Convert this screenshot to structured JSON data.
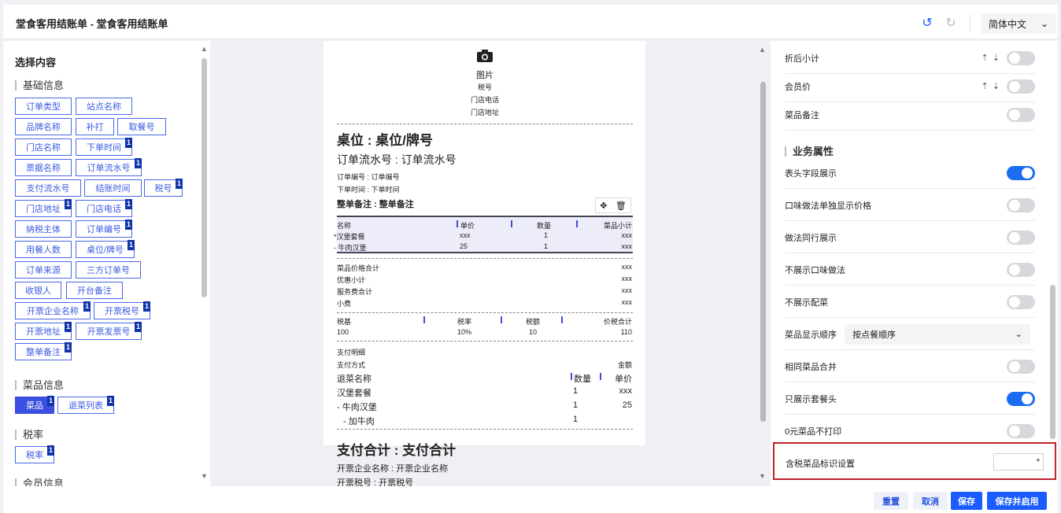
{
  "header": {
    "title": "堂食客用结账单 - 堂食客用结账单",
    "undo_icon": "undo-icon",
    "redo_icon": "redo-icon",
    "language": "简体中文"
  },
  "left": {
    "section_title": "选择内容",
    "groups": [
      {
        "name": "基础信息",
        "items": [
          {
            "label": "订单类型",
            "badge": ""
          },
          {
            "label": "站点名称",
            "badge": ""
          },
          {
            "label": "品牌名称",
            "badge": ""
          },
          {
            "label": "补打",
            "badge": ""
          },
          {
            "label": "取餐号",
            "badge": ""
          },
          {
            "label": "门店名称",
            "badge": ""
          },
          {
            "label": "下单时间",
            "badge": "1"
          },
          {
            "label": "票据名称",
            "badge": ""
          },
          {
            "label": "订单流水号",
            "badge": "1"
          },
          {
            "label": "支付流水号",
            "badge": ""
          },
          {
            "label": "结账时间",
            "badge": ""
          },
          {
            "label": "税号",
            "badge": "1"
          },
          {
            "label": "门店地址",
            "badge": "1"
          },
          {
            "label": "门店电话",
            "badge": "1"
          },
          {
            "label": "纳税主体",
            "badge": ""
          },
          {
            "label": "订单编号",
            "badge": "1"
          },
          {
            "label": "用餐人数",
            "badge": ""
          },
          {
            "label": "桌位/牌号",
            "badge": "1"
          },
          {
            "label": "订单来源",
            "badge": ""
          },
          {
            "label": "三方订单号",
            "badge": ""
          },
          {
            "label": "收银人",
            "badge": ""
          },
          {
            "label": "开台备注",
            "badge": ""
          },
          {
            "label": "开票企业名称",
            "badge": "1"
          },
          {
            "label": "开票税号",
            "badge": "1"
          },
          {
            "label": "开票地址",
            "badge": "1"
          },
          {
            "label": "开票发票号",
            "badge": "1"
          },
          {
            "label": "整单备注",
            "badge": "1"
          }
        ]
      },
      {
        "name": "菜品信息",
        "items": [
          {
            "label": "菜品",
            "badge": "1"
          },
          {
            "label": "退菜列表",
            "badge": "1"
          }
        ]
      },
      {
        "name": "税率",
        "items": [
          {
            "label": "税率",
            "badge": "1"
          }
        ]
      },
      {
        "name": "会员信息",
        "items": []
      }
    ]
  },
  "receipt": {
    "camera_icon": "camera-icon",
    "image_label": "图片",
    "tax_no": "税号",
    "store_phone": "门店电话",
    "store_addr": "门店地址",
    "table_no": "桌位 : 桌位/牌号",
    "serial_no": "订单流水号 : 订单流水号",
    "order_no": "订单编号 : 订单编号",
    "order_time": "下单时间 : 下单时间",
    "order_remark": "整单备注 : 整单备注",
    "move_icon": "move-icon",
    "delete_icon": "trash-icon",
    "dish_table": {
      "headers": [
        "名称",
        "单价",
        "数量",
        "菜品小计"
      ],
      "rows": [
        [
          "*汉堡套餐",
          "xxx",
          "1",
          "xxx"
        ],
        [
          "- 牛肉汉堡",
          "25",
          "1",
          "xxx"
        ]
      ]
    },
    "totals": [
      {
        "label": "菜品价格合计",
        "value": "xxx"
      },
      {
        "label": "优惠小计",
        "value": "xxx"
      },
      {
        "label": "服务费合计",
        "value": "xxx"
      },
      {
        "label": "小费",
        "value": "xxx"
      }
    ],
    "tax_table": {
      "headers": [
        "税基",
        "税率",
        "税额",
        "价税合计"
      ],
      "row": [
        "100",
        "10%",
        "10",
        "110"
      ]
    },
    "pay_detail": "支付明细",
    "pay_method": "支付方式",
    "amount": "金额",
    "refund_table": {
      "headers": [
        "退菜名称",
        "数量",
        "单价"
      ],
      "rows": [
        [
          "汉堡套餐",
          "1",
          "xxx"
        ],
        [
          "- 牛肉汉堡",
          "1",
          "25"
        ],
        [
          "- 加牛肉",
          "1",
          ""
        ]
      ]
    },
    "pay_total": "支付合计 : 支付合计",
    "inv_company": "开票企业名称 : 开票企业名称",
    "inv_tax": "开票税号 : 开票税号"
  },
  "right": {
    "rows_top": [
      {
        "label": "折后小计",
        "sort": true,
        "on": false
      },
      {
        "label": "会员价",
        "sort": true,
        "on": false
      },
      {
        "label": "菜品备注",
        "sort": false,
        "on": false
      }
    ],
    "group_title": "业务属性",
    "rows": [
      {
        "label": "表头字段展示",
        "on": true
      },
      {
        "label": "口味做法单独显示价格",
        "on": false
      },
      {
        "label": "做法同行展示",
        "on": false
      },
      {
        "label": "不展示口味做法",
        "on": false
      },
      {
        "label": "不展示配菜",
        "on": false
      }
    ],
    "display_order": {
      "label": "菜品显示顺序",
      "value": "按点餐顺序"
    },
    "rows2": [
      {
        "label": "相同菜品合并",
        "on": false
      },
      {
        "label": "只展示套餐头",
        "on": true
      },
      {
        "label": "0元菜品不打印",
        "on": false
      }
    ],
    "tax_flag": {
      "label": "含税菜品标识设置",
      "value": "*"
    }
  },
  "footer": {
    "reset": "重置",
    "cancel": "取消",
    "save": "保存",
    "save_enable": "保存并启用"
  },
  "colors": {
    "accent": "#1a5cff",
    "chip": "#4968e8",
    "badge": "#1133aa",
    "highlight": "#c0212c"
  }
}
